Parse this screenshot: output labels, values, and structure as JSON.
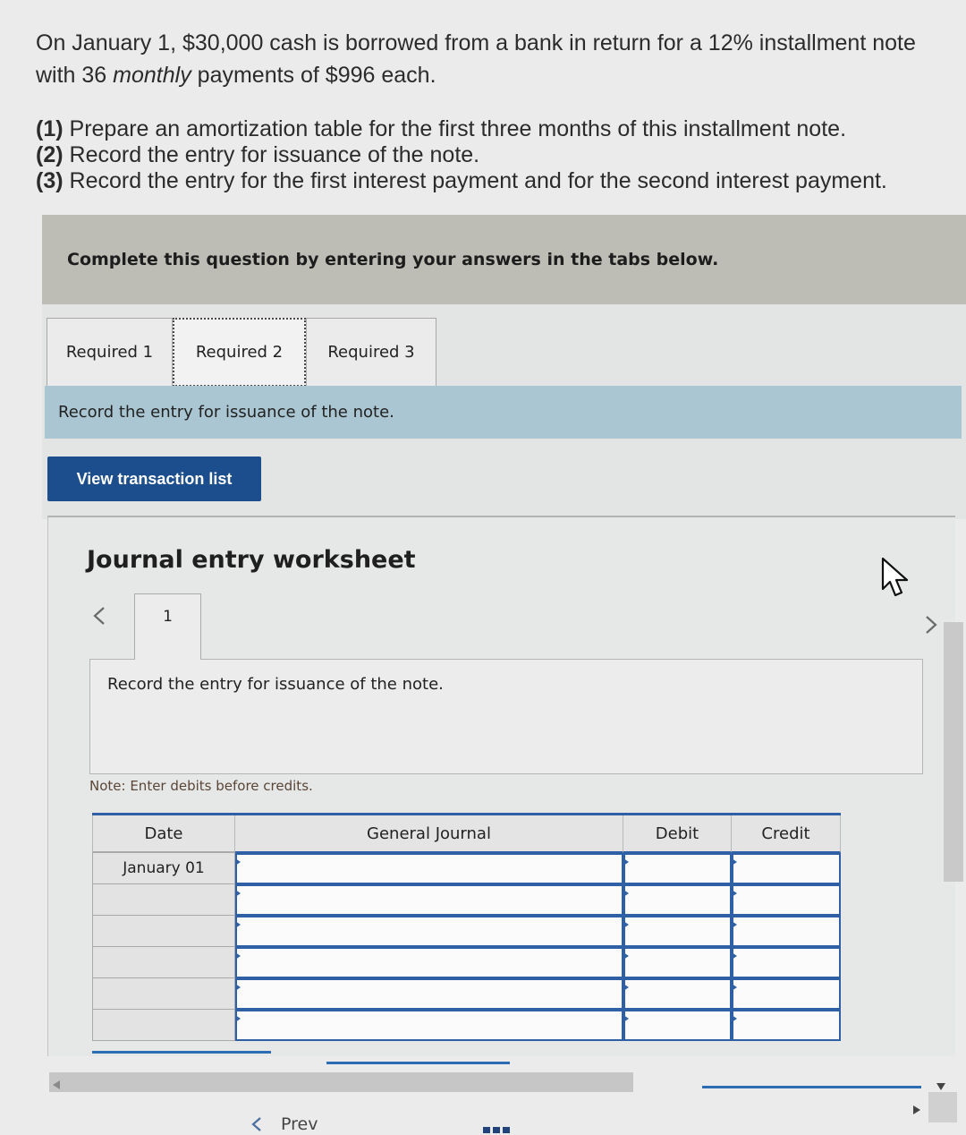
{
  "question": {
    "intro_before": "On January 1, $30,000 cash is borrowed from a bank in return for a 12% installment note with 36 ",
    "intro_italic": "monthly",
    "intro_after": " payments of $996 each.",
    "requirements": [
      {
        "number": "(1)",
        "text": "Prepare an amortization table for the first three months of this installment note."
      },
      {
        "number": "(2)",
        "text": "Record the entry for issuance of the note."
      },
      {
        "number": "(3)",
        "text": "Record the entry for the first interest payment and for the second interest payment."
      }
    ]
  },
  "banner": {
    "text": "Complete this question by entering your answers in the tabs below."
  },
  "tabs": [
    {
      "label": "Required 1",
      "active": false
    },
    {
      "label": "Required 2",
      "active": true
    },
    {
      "label": "Required 3",
      "active": false
    }
  ],
  "tab_instruction": "Record the entry for issuance of the note.",
  "view_transaction_list_button": "View transaction list",
  "worksheet": {
    "title": "Journal entry worksheet",
    "entry_tabs": [
      {
        "label": "1",
        "active": true
      }
    ],
    "prompt": "Record the entry for issuance of the note.",
    "note": "Note: Enter debits before credits.",
    "table": {
      "headers": {
        "date": "Date",
        "account": "General Journal",
        "debit": "Debit",
        "credit": "Credit"
      },
      "rows": [
        {
          "date": "January 01",
          "account": "",
          "debit": "",
          "credit": ""
        },
        {
          "date": "",
          "account": "",
          "debit": "",
          "credit": ""
        },
        {
          "date": "",
          "account": "",
          "debit": "",
          "credit": ""
        },
        {
          "date": "",
          "account": "",
          "debit": "",
          "credit": ""
        },
        {
          "date": "",
          "account": "",
          "debit": "",
          "credit": ""
        },
        {
          "date": "",
          "account": "",
          "debit": "",
          "credit": ""
        }
      ]
    }
  },
  "footer": {
    "prev_label": "Prev"
  },
  "icons": {
    "worksheet_prev": "chevron-left-icon",
    "worksheet_next": "chevron-right-icon",
    "cursor": "mouse-pointer-icon",
    "scroll_left": "arrow-left-icon",
    "scroll_down": "arrow-down-icon",
    "scroll_right": "arrow-right-icon",
    "footer_prev": "chevron-left-icon",
    "question_grid": "grid-icon"
  },
  "colors": {
    "banner_bg": "#bdbdb5",
    "instruction_bg": "#a9c6d2",
    "button_bg": "#1c4e8e",
    "input_border": "#2f5fa5"
  }
}
